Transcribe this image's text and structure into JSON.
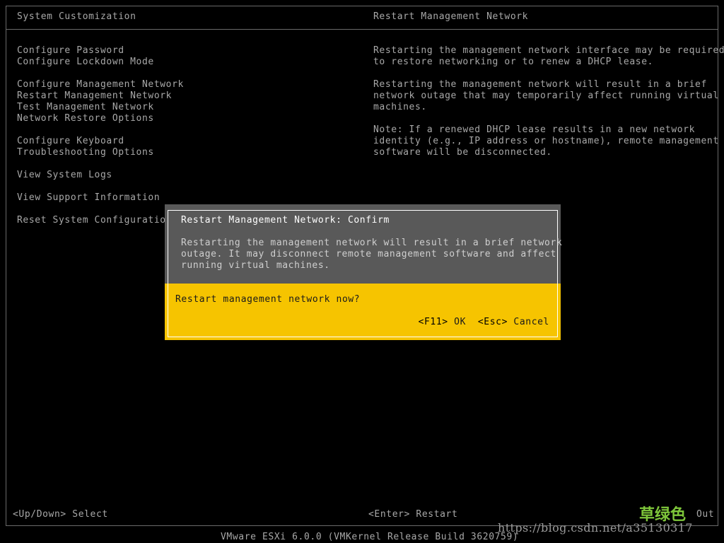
{
  "header": {
    "left_title": "System Customization",
    "right_title": "Restart Management Network"
  },
  "menu": {
    "items": [
      "Configure Password",
      "Configure Lockdown Mode",
      "Configure Management Network",
      "Restart Management Network",
      "Test Management Network",
      "Network Restore Options",
      "Configure Keyboard",
      "Troubleshooting Options",
      "View System Logs",
      "View Support Information",
      "Reset System Configuration"
    ]
  },
  "description": {
    "para1_line1": "Restarting the management network interface may be required",
    "para1_line2": "to restore networking or to renew a DHCP lease.",
    "para2_line1": "Restarting the management network will result in a brief",
    "para2_line2": "network outage that may temporarily affect running virtual",
    "para2_line3": "machines.",
    "para3_line1": "Note: If a renewed DHCP lease results in a new network",
    "para3_line2": "identity (e.g., IP address or hostname), remote management",
    "para3_line3": "software will be disconnected."
  },
  "dialog": {
    "title": "Restart Management Network: Confirm",
    "body_line1": "Restarting the management network will result in a brief network",
    "body_line2": "outage. It may disconnect remote management software and affect",
    "body_line3": "running virtual machines.",
    "question": "Restart management network now?",
    "ok_key": "<F11>",
    "ok_label": " OK",
    "cancel_key": "<Esc>",
    "cancel_label": " Cancel"
  },
  "status_bar": {
    "left": "<Up/Down> Select",
    "middle": "<Enter> Restart",
    "right": "Out"
  },
  "footer": {
    "text": "VMware ESXi 6.0.0 (VMKernel Release Build 3620759)"
  },
  "watermark": {
    "logo_text": "草绿色",
    "url": "https://blog.csdn.net/a35130317"
  },
  "colors": {
    "background": "#000000",
    "text": "#a8a8a8",
    "dialog_top": "#595959",
    "dialog_accent": "#f6c400"
  }
}
